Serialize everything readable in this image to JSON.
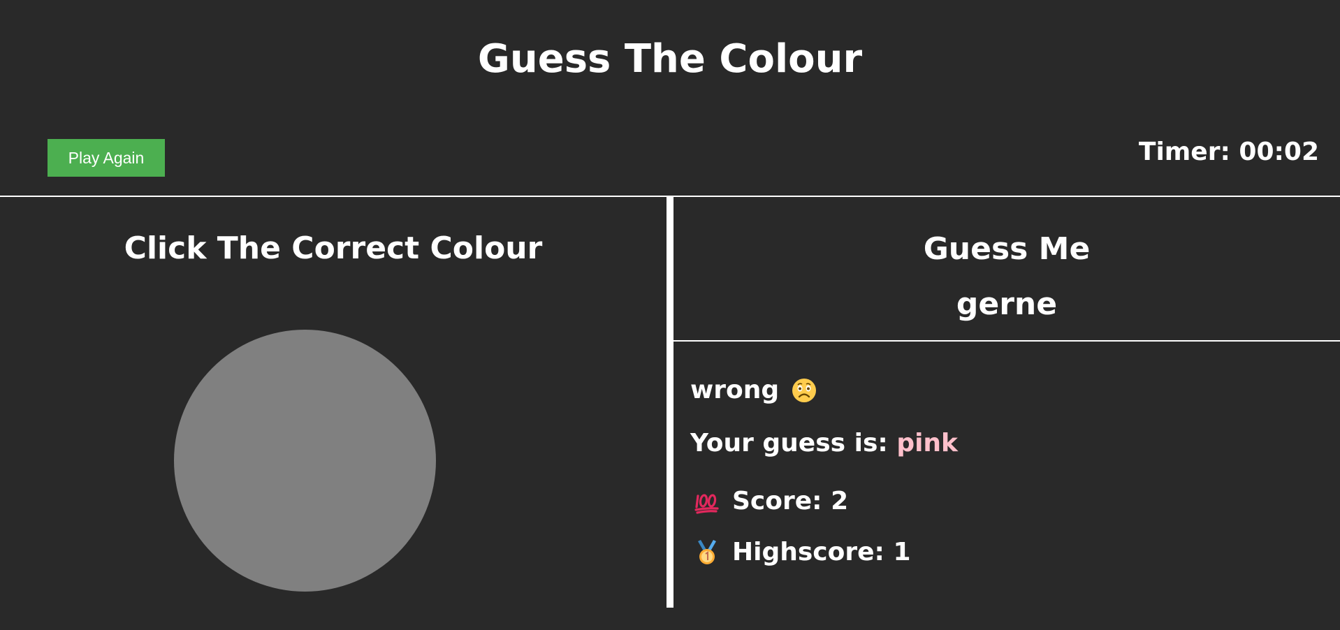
{
  "header": {
    "title": "Guess The Colour",
    "play_again_label": "Play Again",
    "timer_text": "Timer: 00:02"
  },
  "left_panel": {
    "heading": "Click The Correct Colour",
    "circle_color": "#808080"
  },
  "right_panel": {
    "heading": "Guess Me",
    "word": "gerne",
    "result_text": "wrong",
    "result_icon": "sad-face-icon",
    "guess_label": "Your guess is: ",
    "guess_value": "pink",
    "guess_value_color": "#ffc0cb",
    "score_icon": "hundred-points-icon",
    "score_text": "Score: 2",
    "highscore_icon": "gold-medal-icon",
    "highscore_text": "Highscore: 1"
  },
  "colors": {
    "background": "#292929",
    "text": "#ffffff",
    "button": "#4caf50",
    "divider": "#ffffff"
  }
}
